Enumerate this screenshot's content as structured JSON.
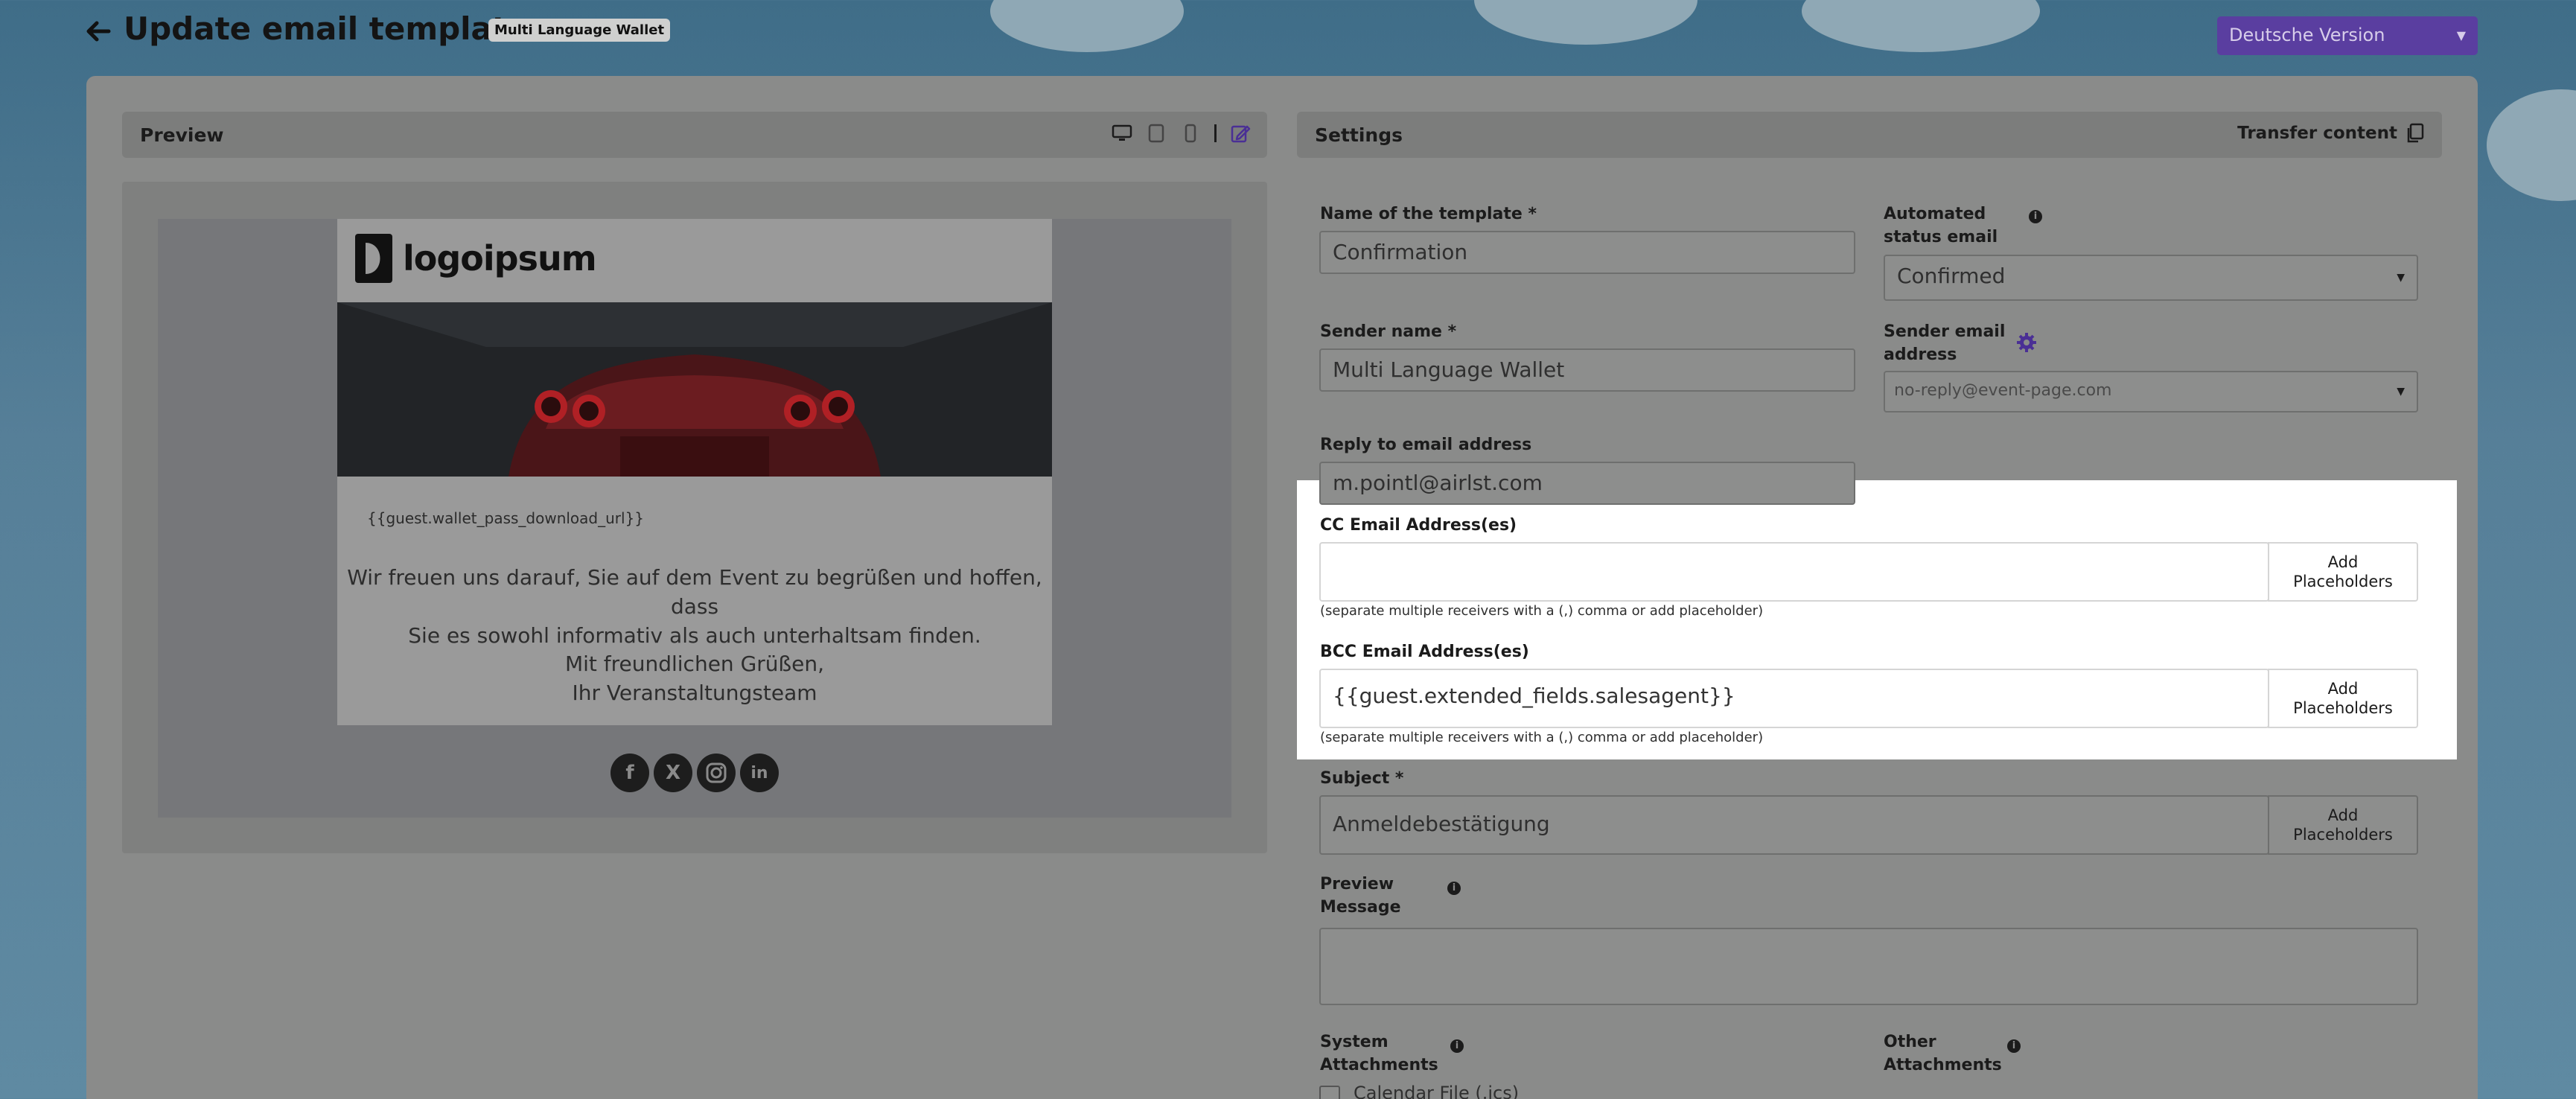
{
  "header": {
    "title": "Update email template",
    "badge": "Multi Language Wallet",
    "language_select": "Deutsche Version"
  },
  "preview": {
    "title": "Preview",
    "tools": [
      "desktop-icon",
      "tablet-icon",
      "mobile-icon",
      "edit-icon"
    ],
    "email": {
      "logo_text": "logoipsum",
      "placeholder_url": "{{guest.wallet_pass_download_url}}",
      "body_line1": "Wir freuen uns darauf, Sie auf dem Event zu begrüßen und hoffen, dass",
      "body_line2": "Sie es sowohl informativ als auch unterhaltsam finden.",
      "sign_line1": "Mit freundlichen Grüßen,",
      "sign_line2": "Ihr Veranstaltungsteam",
      "social": [
        "facebook-icon",
        "x-icon",
        "instagram-icon",
        "linkedin-icon"
      ]
    }
  },
  "settings": {
    "title": "Settings",
    "transfer_label": "Transfer content",
    "template_name": {
      "label": "Name of the template *",
      "value": "Confirmation"
    },
    "automated_status": {
      "label_line1": "Automated",
      "label_line2": "status email",
      "value": "Confirmed"
    },
    "sender_name": {
      "label": "Sender name *",
      "value": "Multi Language Wallet"
    },
    "sender_email": {
      "label_line1": "Sender email",
      "label_line2": "address",
      "value": "no-reply@event-page.com"
    },
    "reply_to": {
      "label": "Reply to email address",
      "value": "m.pointl@airlst.com"
    },
    "cc": {
      "label": "CC Email Address(es)",
      "value": "",
      "hint": "(separate multiple receivers with a (,) comma or add placeholder)",
      "add_button_line1": "Add",
      "add_button_line2": "Placeholders"
    },
    "bcc": {
      "label": "BCC Email Address(es)",
      "value": "{{guest.extended_fields.salesagent}}",
      "hint": "(separate multiple receivers with a (,) comma or add placeholder)",
      "add_button_line1": "Add",
      "add_button_line2": "Placeholders"
    },
    "subject": {
      "label": "Subject *",
      "value": "Anmeldebestätigung",
      "add_button_line1": "Add",
      "add_button_line2": "Placeholders"
    },
    "preview_message": {
      "label_line1": "Preview",
      "label_line2": "Message",
      "value": ""
    },
    "system_attachments": {
      "label_line1": "System",
      "label_line2": "Attachments",
      "calendar_label": "Calendar File (.ics)"
    },
    "other_attachments": {
      "label_line1": "Other",
      "label_line2": "Attachments"
    }
  },
  "colors": {
    "accent": "#5a3ea0",
    "highlight": "#ffffff"
  }
}
